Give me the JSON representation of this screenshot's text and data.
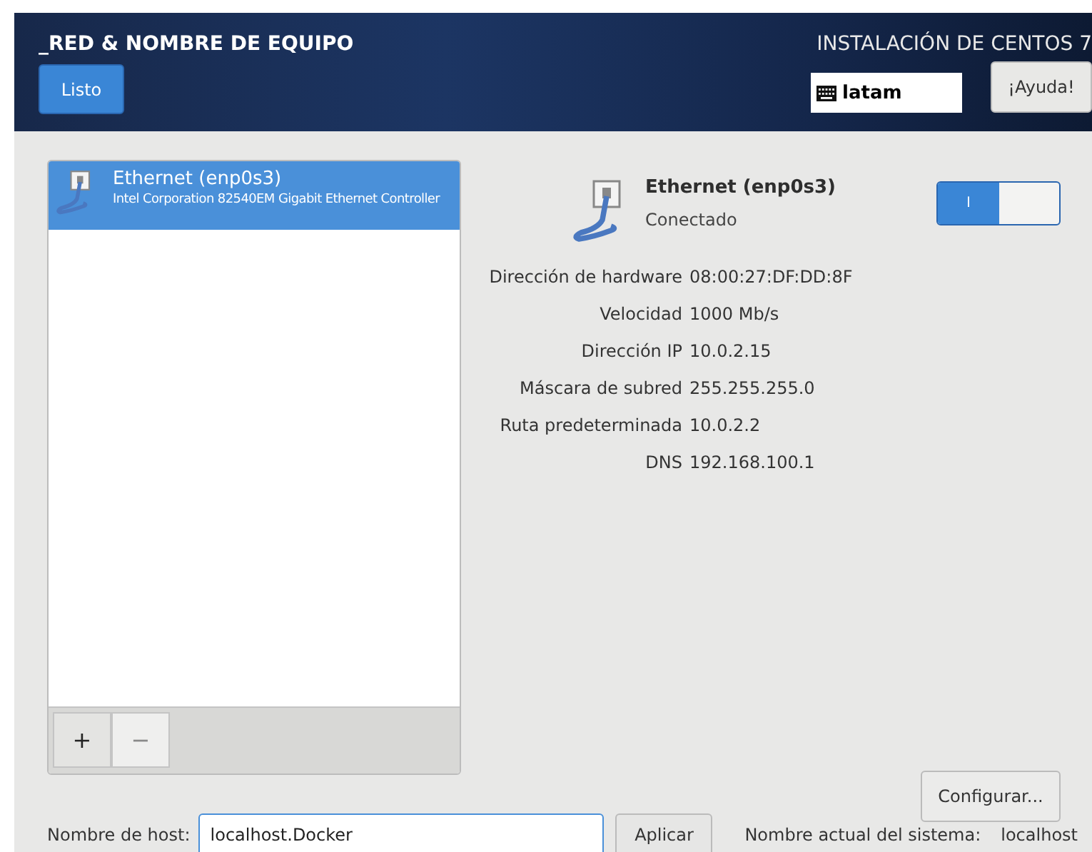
{
  "header": {
    "title": "_RED & NOMBRE DE EQUIPO",
    "done_button": "Listo",
    "product": "INSTALACIÓN DE CENTOS 7",
    "keyboard": "latam",
    "help_button": "¡Ayuda!"
  },
  "devices": [
    {
      "name": "Ethernet (enp0s3)",
      "description": "Intel Corporation 82540EM Gigabit Ethernet Controller",
      "selected": true
    }
  ],
  "list_buttons": [
    {
      "label": "+",
      "disabled": false
    },
    {
      "label": "−",
      "disabled": true
    }
  ],
  "details": {
    "name": "Ethernet (enp0s3)",
    "status": "Conectado",
    "toggle": {
      "label": "I",
      "on": true
    },
    "rows": [
      {
        "label": "Dirección de hardware",
        "value": "08:00:27:DF:DD:8F"
      },
      {
        "label": "Velocidad",
        "value": "1000 Mb/s"
      },
      {
        "label": "Dirección IP",
        "value": "10.0.2.15"
      },
      {
        "label": "Máscara de subred",
        "value": "255.255.255.0"
      },
      {
        "label": "Ruta predeterminada",
        "value": "10.0.2.2"
      },
      {
        "label": "DNS",
        "value": "192.168.100.1"
      }
    ],
    "configure_button": "Configurar..."
  },
  "hostname": {
    "label": "Nombre de host:",
    "value": "localhost.Docker",
    "apply_button": "Aplicar",
    "current_label": "Nombre actual del sistema:",
    "current_value": "localhost"
  }
}
